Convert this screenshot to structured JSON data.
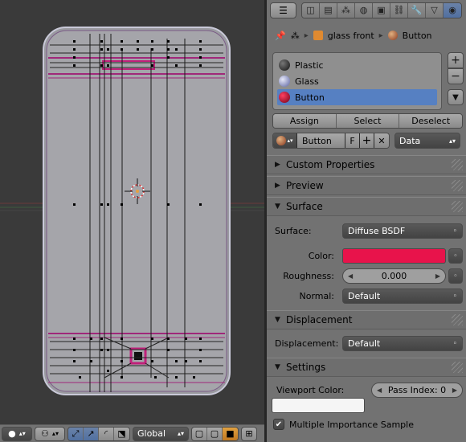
{
  "viewport": {
    "header": {
      "shading_icon": "sphere-shading-icon",
      "pivot_icon": "pivot-icon",
      "orientation": "Global",
      "manipulator_icons": [
        "manipulator-translate-icon",
        "manipulator-move-icon",
        "manipulator-rotate-icon",
        "manipulator-scale-icon"
      ],
      "layer_icons": [
        "cube-layer-icon",
        "cube-layer-icon",
        "cube-layer-icon"
      ],
      "snap_icon": "snap-icon"
    }
  },
  "props": {
    "context_tabs": [
      "render-icon",
      "layers-icon",
      "scene-icon",
      "world-icon",
      "object-icon",
      "constraints-icon",
      "modifier-icon",
      "data-icon",
      "material-icon"
    ],
    "active_tab": 8,
    "breadcrumb": {
      "object": "glass front",
      "material": "Button"
    },
    "slots": [
      {
        "name": "Plastic",
        "color": "#2a2a2a"
      },
      {
        "name": "Glass",
        "color": "#8d96c8"
      },
      {
        "name": "Button",
        "color": "#b0002a"
      }
    ],
    "selected_slot": 2,
    "slot_buttons": {
      "add": "+",
      "remove": "−",
      "menu": "▼"
    },
    "assign_row": {
      "assign": "Assign",
      "select": "Select",
      "deselect": "Deselect"
    },
    "datablock": {
      "name": "Button",
      "fake": "F",
      "plus": "+",
      "x": "✕",
      "link": "Data"
    },
    "panels": {
      "custom_properties": "Custom Properties",
      "preview": "Preview",
      "surface": "Surface",
      "displacement": "Displacement",
      "settings": "Settings"
    },
    "surface": {
      "surface_label": "Surface:",
      "surface_value": "Diffuse BSDF",
      "color_label": "Color:",
      "color_value": "#e8134b",
      "roughness_label": "Roughness:",
      "roughness_value": "0.000",
      "normal_label": "Normal:",
      "normal_value": "Default"
    },
    "displacement": {
      "label": "Displacement:",
      "value": "Default"
    },
    "settings": {
      "viewport_color_label": "Viewport Color:",
      "pass_index": "Pass Index: 0",
      "viewport_color": "#f5f5f5",
      "mis_label": "Multiple Importance Sample",
      "mis_checked": true
    }
  }
}
